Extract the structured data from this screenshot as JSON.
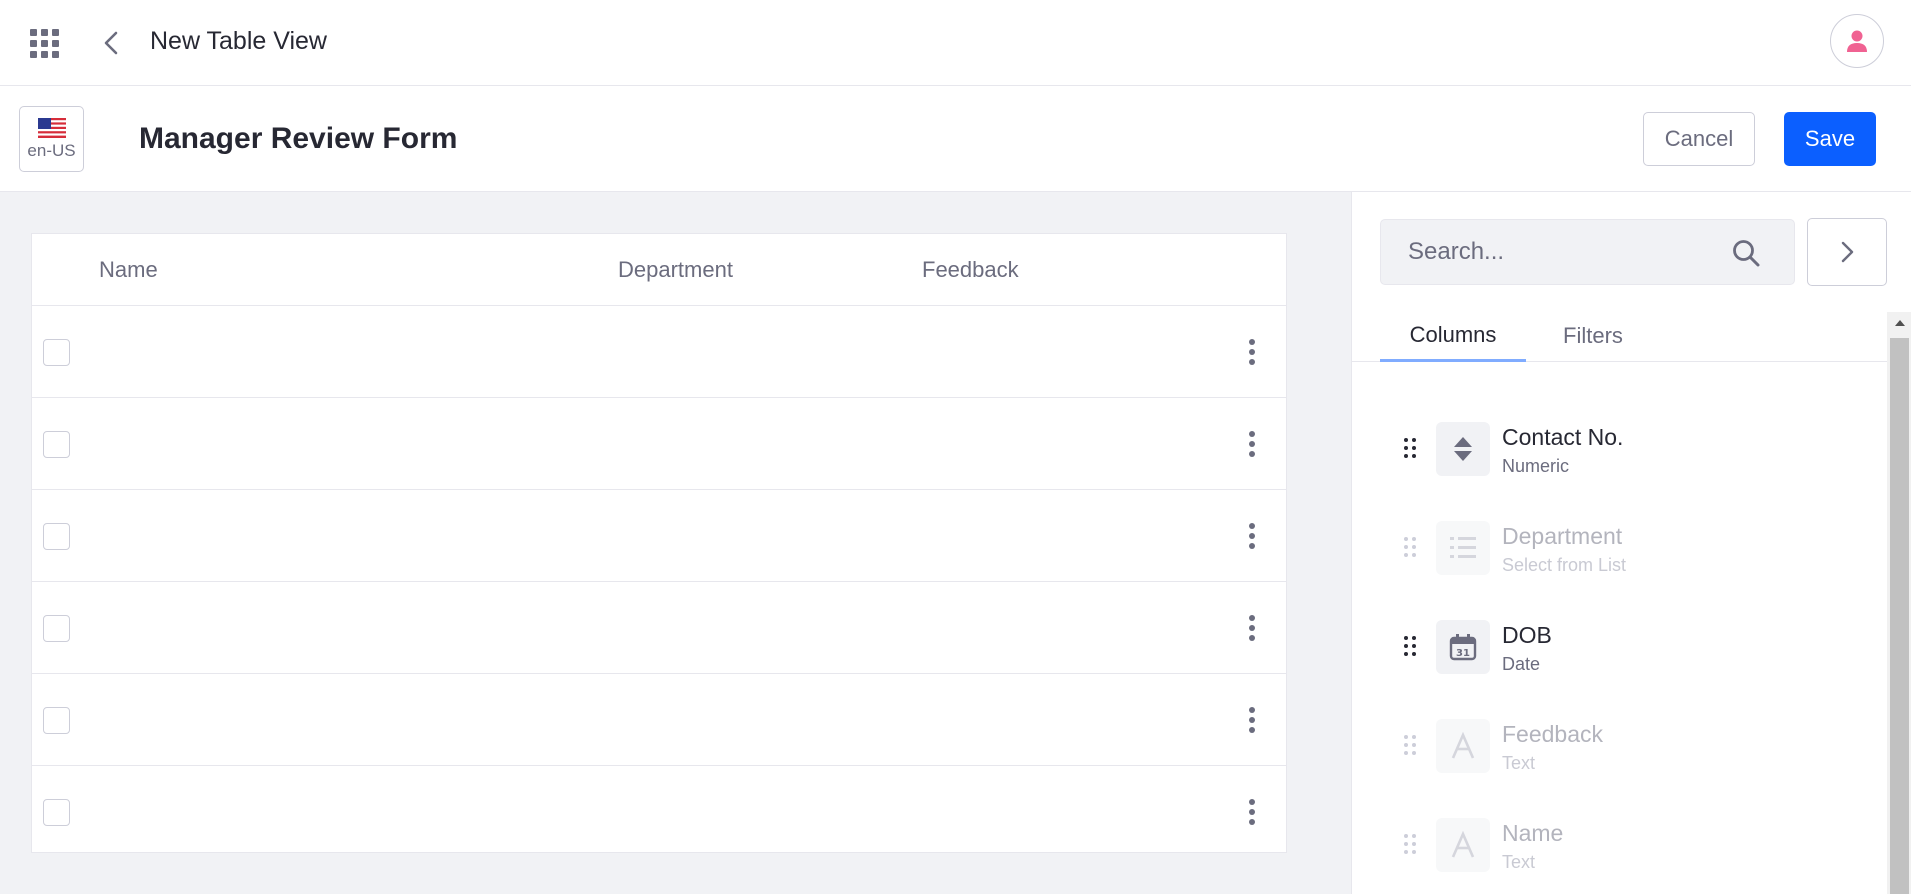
{
  "topbar": {
    "title": "New Table View",
    "apps_icon": "grid-apps-icon",
    "back_icon": "chevron-left-icon",
    "avatar_icon": "user-icon"
  },
  "header": {
    "locale_code": "en-US",
    "form_title": "Manager Review Form",
    "cancel_label": "Cancel",
    "save_label": "Save"
  },
  "table": {
    "columns": [
      "Name",
      "Department",
      "Feedback"
    ],
    "row_count": 6
  },
  "sidebar": {
    "search_placeholder": "Search...",
    "tabs": [
      {
        "label": "Columns",
        "active": true
      },
      {
        "label": "Filters",
        "active": false
      }
    ],
    "fields": [
      {
        "label": "Contact No.",
        "type": "Numeric",
        "icon": "numeric-stepper-icon",
        "enabled": true
      },
      {
        "label": "Department",
        "type": "Select from List",
        "icon": "list-icon",
        "enabled": false
      },
      {
        "label": "DOB",
        "type": "Date",
        "icon": "calendar-icon",
        "enabled": true
      },
      {
        "label": "Feedback",
        "type": "Text",
        "icon": "text-icon",
        "enabled": false
      },
      {
        "label": "Name",
        "type": "Text",
        "icon": "text-icon",
        "enabled": false
      }
    ]
  },
  "colors": {
    "primary": "#0b5fff",
    "avatar_accent": "#f06292",
    "text": "#272833",
    "muted": "#6b6c7e",
    "tab_underline": "#80acff",
    "canvas": "#f1f2f5"
  }
}
